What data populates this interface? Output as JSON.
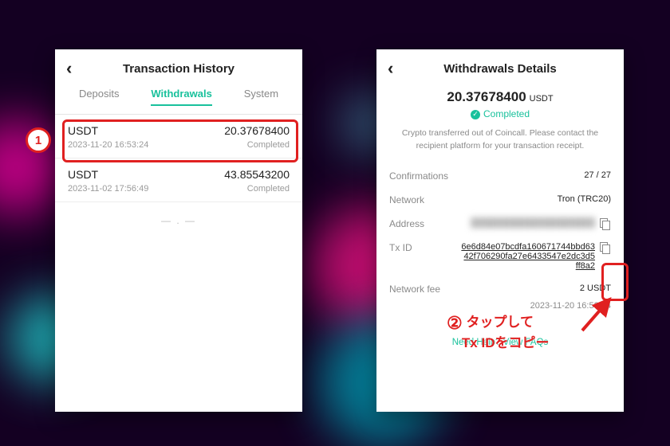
{
  "annotations": {
    "step1": "1",
    "step2": "②",
    "copy_hint_l1": "タップして",
    "copy_hint_l2": "Tx IDをコピー"
  },
  "left": {
    "title": "Transaction History",
    "tabs": {
      "deposits": "Deposits",
      "withdrawals": "Withdrawals",
      "system": "System",
      "active": "withdrawals"
    },
    "rows": [
      {
        "symbol": "USDT",
        "ts": "2023-11-20 16:53:24",
        "amount": "20.37678400",
        "status": "Completed"
      },
      {
        "symbol": "USDT",
        "ts": "2023-11-02 17:56:49",
        "amount": "43.85543200",
        "status": "Completed"
      }
    ],
    "end": "— . —"
  },
  "right": {
    "title": "Withdrawals Details",
    "amount": "20.37678400",
    "currency": "USDT",
    "status": "Completed",
    "desc": "Crypto transferred out of Coincall. Please contact the recipient platform for your transaction receipt.",
    "kv": {
      "confirmations_k": "Confirmations",
      "confirmations_v": "27 / 27",
      "network_k": "Network",
      "network_v": "Tron (TRC20)",
      "address_k": "Address",
      "address_v": "████████████████████",
      "txid_k": "Tx ID",
      "txid_v": "6e6d84e07bcdfa160671744bbd63 42f706290fa27e6433547e2dc3d5 ff8a2",
      "fee_k": "Network fee",
      "fee_v": "2 USDT",
      "ts_v": "2023-11-20 16:53:24"
    },
    "faq": "Need Help? View FAQs"
  }
}
